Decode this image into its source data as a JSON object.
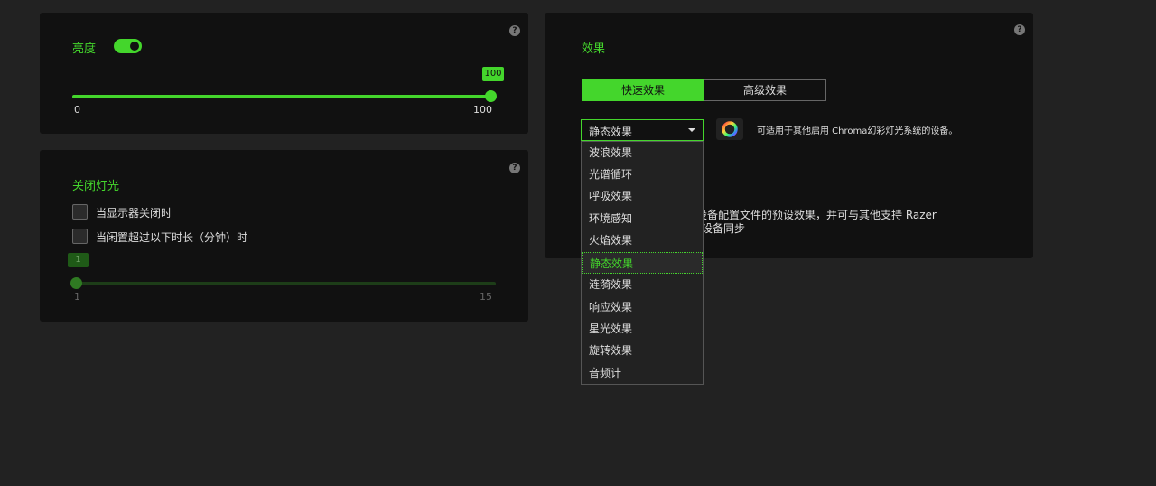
{
  "brightness": {
    "title": "亮度",
    "enabled": true,
    "value": "100",
    "level_fraction": 1.0,
    "min_label": "0",
    "max_label": "100",
    "help": "?"
  },
  "lights_off": {
    "title": "关闭灯光",
    "help": "?",
    "options": [
      {
        "label": "当显示器关闭时",
        "checked": false
      },
      {
        "label": "当闲置超过以下时长（分钟）时",
        "checked": false
      }
    ],
    "idle_value": "1",
    "idle_fraction": 0.0,
    "min_label": "1",
    "max_label": "15"
  },
  "effects": {
    "title": "效果",
    "help": "?",
    "tabs": [
      {
        "label": "快速效果",
        "active": true
      },
      {
        "label": "高级效果",
        "active": false
      }
    ],
    "selected": "静态效果",
    "chroma_note": "可适用于其他启用 Chroma幻彩灯光系统的设备。",
    "description_line1": "设备配置文件的预设效果，并可与其他支持 Razer",
    "description_line2": "设备同步",
    "menu_items": [
      "波浪效果",
      "光谱循环",
      "呼吸效果",
      "环境感知",
      "火焰效果",
      "静态效果",
      "涟漪效果",
      "响应效果",
      "星光效果",
      "旋转效果",
      "音频计"
    ]
  },
  "colors": {
    "accent": "#44d62c",
    "panel": "#111111",
    "background": "#222222"
  },
  "icons": [
    "help-icon",
    "chevron-down-icon",
    "chroma-color-wheel-icon"
  ]
}
